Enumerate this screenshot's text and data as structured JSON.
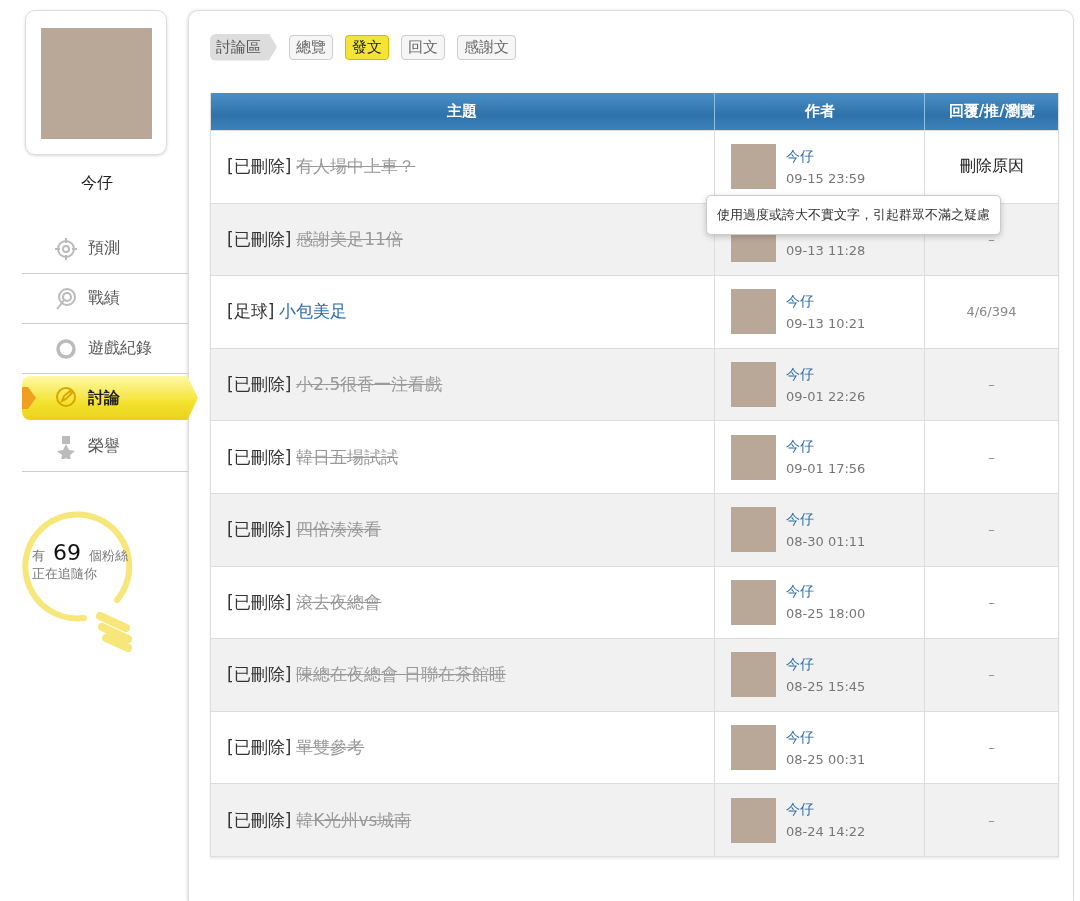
{
  "sidebar": {
    "profile_name": "今仔",
    "menu": [
      {
        "label": "預測",
        "selected": false
      },
      {
        "label": "戰績",
        "selected": false
      },
      {
        "label": "遊戲紀錄",
        "selected": false
      },
      {
        "label": "討論",
        "selected": true
      },
      {
        "label": "榮譽",
        "selected": false
      }
    ],
    "fans": {
      "prefix": "有",
      "count": "69",
      "suffix": "個粉絲",
      "line2": "正在追隨你"
    }
  },
  "section_label": "討論區",
  "tabs": [
    {
      "label": "總覽",
      "selected": false
    },
    {
      "label": "發文",
      "selected": true
    },
    {
      "label": "回文",
      "selected": false
    },
    {
      "label": "感謝文",
      "selected": false
    }
  ],
  "table": {
    "columns": [
      "主題",
      "作者",
      "回覆/推/瀏覽"
    ],
    "rows": [
      {
        "tag": "[已刪除]",
        "title": "有人場中上車？",
        "deleted": true,
        "author": "今仔",
        "time": "09-15 23:59",
        "stats": "刪除原因",
        "kind": "reason",
        "tooltip": "使用過度或誇大不實文字，引起群眾不滿之疑慮"
      },
      {
        "tag": "[已刪除]",
        "title": "感謝美足11倍",
        "deleted": true,
        "time": "09-13 11:28",
        "stats": "–",
        "kind": "plain"
      },
      {
        "tag": "[足球]",
        "title": "小包美足",
        "deleted": false,
        "author": "今仔",
        "time": "09-13 10:21",
        "stats": "4/6/394",
        "kind": "plain"
      },
      {
        "tag": "[已刪除]",
        "title": "小2.5很香一注看戲",
        "deleted": true,
        "author": "今仔",
        "time": "09-01 22:26",
        "stats": "–",
        "kind": "plain"
      },
      {
        "tag": "[已刪除]",
        "title": "韓日五場試試",
        "deleted": true,
        "author": "今仔",
        "time": "09-01 17:56",
        "stats": "–",
        "kind": "plain"
      },
      {
        "tag": "[已刪除]",
        "title": "四倍湊湊看",
        "deleted": true,
        "author": "今仔",
        "time": "08-30 01:11",
        "stats": "–",
        "kind": "plain"
      },
      {
        "tag": "[已刪除]",
        "title": "滾去夜總會",
        "deleted": true,
        "author": "今仔",
        "time": "08-25 18:00",
        "stats": "–",
        "kind": "plain"
      },
      {
        "tag": "[已刪除]",
        "title": "陳總在夜總會 日聯在茶館睡",
        "deleted": true,
        "author": "今仔",
        "time": "08-25 15:45",
        "stats": "–",
        "kind": "plain"
      },
      {
        "tag": "[已刪除]",
        "title": "單雙參考",
        "deleted": true,
        "author": "今仔",
        "time": "08-25 00:31",
        "stats": "–",
        "kind": "plain"
      },
      {
        "tag": "[已刪除]",
        "title": "韓K光州vs城南",
        "deleted": true,
        "author": "今仔",
        "time": "08-24 14:22",
        "stats": "–",
        "kind": "plain"
      }
    ]
  }
}
